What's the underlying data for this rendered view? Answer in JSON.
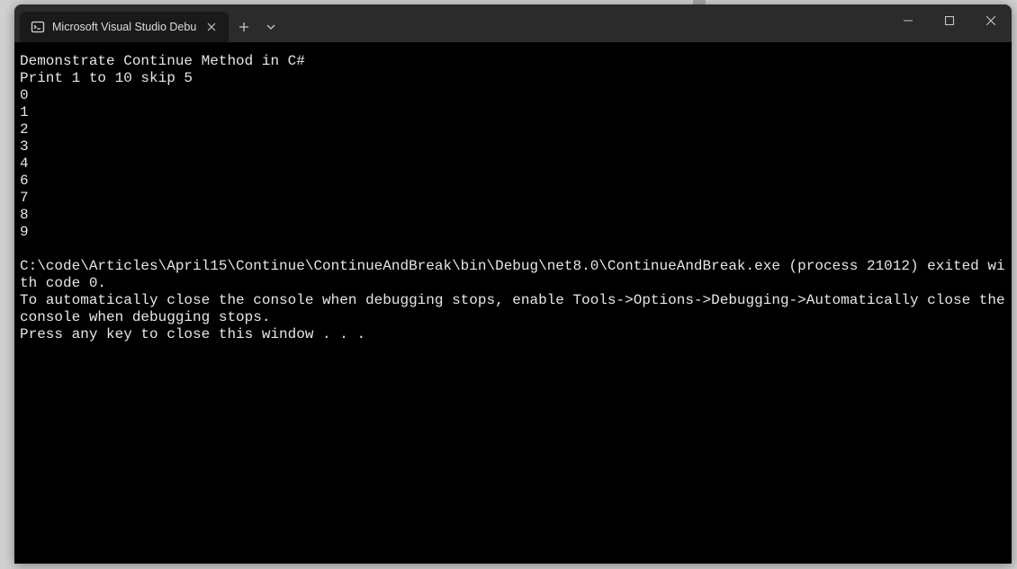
{
  "titlebar": {
    "tab_title": "Microsoft Visual Studio Debug",
    "new_tab_tooltip": "New tab",
    "dropdown_tooltip": "Tab actions",
    "minimize_tooltip": "Minimize",
    "maximize_tooltip": "Maximize",
    "close_tooltip": "Close"
  },
  "console": {
    "lines": [
      "Demonstrate Continue Method in C#",
      "Print 1 to 10 skip 5",
      "0",
      "1",
      "2",
      "3",
      "4",
      "6",
      "7",
      "8",
      "9",
      "",
      "C:\\code\\Articles\\April15\\Continue\\ContinueAndBreak\\bin\\Debug\\net8.0\\ContinueAndBreak.exe (process 21012) exited with code 0.",
      "To automatically close the console when debugging stops, enable Tools->Options->Debugging->Automatically close the console when debugging stops.",
      "Press any key to close this window . . ."
    ]
  }
}
